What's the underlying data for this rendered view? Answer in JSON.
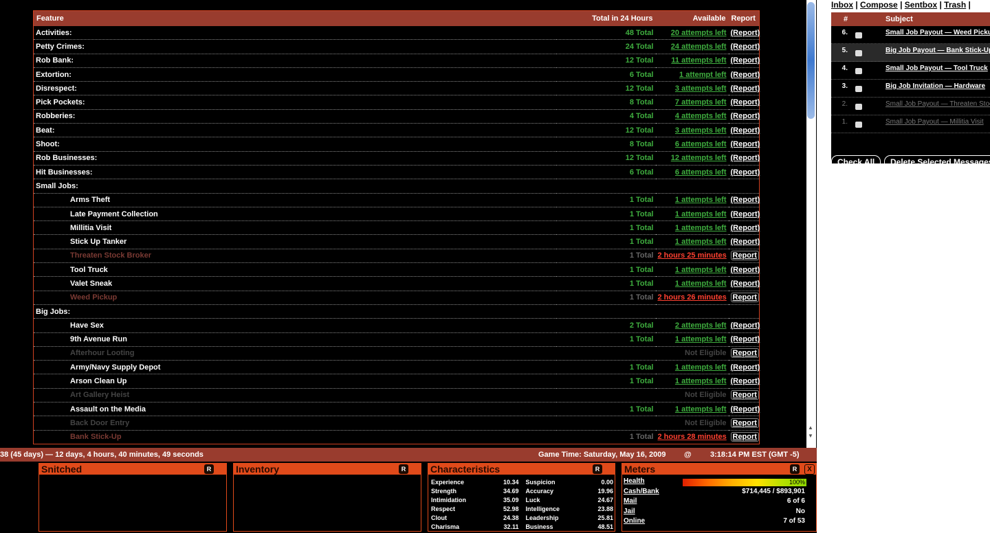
{
  "table": {
    "headers": {
      "feature": "Feature",
      "total": "Total in 24 Hours",
      "available": "Available",
      "report": "Report"
    },
    "rows": [
      {
        "name": "Activities:",
        "total": "48 Total",
        "available": "20 attempts left",
        "report": "(Report)",
        "state": "ok",
        "level": 0
      },
      {
        "name": "Petty Crimes:",
        "total": "24 Total",
        "available": "24 attempts left",
        "report": "(Report)",
        "state": "ok",
        "level": 0
      },
      {
        "name": "Rob Bank:",
        "total": "12 Total",
        "available": "11 attempts left",
        "report": "(Report)",
        "state": "ok",
        "level": 0
      },
      {
        "name": "Extortion:",
        "total": "6 Total",
        "available": "1 attempt left",
        "report": "(Report)",
        "state": "ok",
        "level": 0
      },
      {
        "name": "Disrespect:",
        "total": "12 Total",
        "available": "3 attempts left",
        "report": "(Report)",
        "state": "ok",
        "level": 0
      },
      {
        "name": "Pick Pockets:",
        "total": "8 Total",
        "available": "7 attempts left",
        "report": "(Report)",
        "state": "ok",
        "level": 0
      },
      {
        "name": "Robberies:",
        "total": "4 Total",
        "available": "4 attempts left",
        "report": "(Report)",
        "state": "ok",
        "level": 0
      },
      {
        "name": "Beat:",
        "total": "12 Total",
        "available": "3 attempts left",
        "report": "(Report)",
        "state": "ok",
        "level": 0
      },
      {
        "name": "Shoot:",
        "total": "8 Total",
        "available": "6 attempts left",
        "report": "(Report)",
        "state": "ok",
        "level": 0
      },
      {
        "name": "Rob Businesses:",
        "total": "12 Total",
        "available": "12 attempts left",
        "report": "(Report)",
        "state": "ok",
        "level": 0
      },
      {
        "name": "Hit Businesses:",
        "total": "6 Total",
        "available": "6 attempts left",
        "report": "(Report)",
        "state": "ok",
        "level": 0
      },
      {
        "name": "Small Jobs:",
        "total": "",
        "available": "",
        "report": "",
        "state": "head",
        "level": 0
      },
      {
        "name": "Arms Theft",
        "total": "1 Total",
        "available": "1 attempts left",
        "report": "(Report)",
        "state": "ok",
        "level": 1
      },
      {
        "name": "Late Payment Collection",
        "total": "1 Total",
        "available": "1 attempts left",
        "report": "(Report)",
        "state": "ok",
        "level": 1
      },
      {
        "name": "Millitia Visit",
        "total": "1 Total",
        "available": "1 attempts left",
        "report": "(Report)",
        "state": "ok",
        "level": 1
      },
      {
        "name": "Stick Up Tanker",
        "total": "1 Total",
        "available": "1 attempts left",
        "report": "(Report)",
        "state": "ok",
        "level": 1
      },
      {
        "name": "Threaten Stock Broker",
        "total": "1 Total",
        "available": "2 hours 25 minutes",
        "report": "Report",
        "state": "dim",
        "level": 1
      },
      {
        "name": "Tool Truck",
        "total": "1 Total",
        "available": "1 attempts left",
        "report": "(Report)",
        "state": "ok",
        "level": 1
      },
      {
        "name": "Valet Sneak",
        "total": "1 Total",
        "available": "1 attempts left",
        "report": "(Report)",
        "state": "ok",
        "level": 1
      },
      {
        "name": "Weed Pickup",
        "total": "1 Total",
        "available": "2 hours 26 minutes",
        "report": "Report",
        "state": "dim",
        "level": 1
      },
      {
        "name": "Big Jobs:",
        "total": "",
        "available": "",
        "report": "",
        "state": "head",
        "level": 0
      },
      {
        "name": "Have Sex",
        "total": "2 Total",
        "available": "2 attempts left",
        "report": "(Report)",
        "state": "ok",
        "level": 1
      },
      {
        "name": "9th Avenue Run",
        "total": "1 Total",
        "available": "1 attempts left",
        "report": "(Report)",
        "state": "ok",
        "level": 1
      },
      {
        "name": "Afterhour Looting",
        "total": "",
        "available": "Not Eligible",
        "report": "Report",
        "state": "ne",
        "level": 1
      },
      {
        "name": "Army/Navy Supply Depot",
        "total": "1 Total",
        "available": "1 attempts left",
        "report": "(Report)",
        "state": "ok",
        "level": 1
      },
      {
        "name": "Arson Clean Up",
        "total": "1 Total",
        "available": "1 attempts left",
        "report": "(Report)",
        "state": "ok",
        "level": 1
      },
      {
        "name": "Art Gallery Heist",
        "total": "",
        "available": "Not Eligible",
        "report": "Report",
        "state": "ne",
        "level": 1
      },
      {
        "name": "Assault on the Media",
        "total": "1 Total",
        "available": "1 attempts left",
        "report": "(Report)",
        "state": "ok",
        "level": 1
      },
      {
        "name": "Back Door Entry",
        "total": "",
        "available": "Not Eligible",
        "report": "Report",
        "state": "ne",
        "level": 1
      },
      {
        "name": "Bank Stick-Up",
        "total": "1 Total",
        "available": "2 hours 28 minutes",
        "report": "Report",
        "state": "dim",
        "level": 1
      }
    ]
  },
  "status": {
    "age": "38 (45 days) — 12 days, 4 hours, 40 minutes, 49 seconds",
    "game_time": "Game Time: Saturday, May 16, 2009",
    "at": "@",
    "clock": "3:18:14 PM EST (GMT -5)"
  },
  "panels": {
    "snitched": {
      "title": "Snitched",
      "badge": "R"
    },
    "inventory": {
      "title": "Inventory",
      "badge": "R"
    },
    "characteristics": {
      "title": "Characteristics",
      "badge": "R",
      "left": [
        {
          "label": "Experience",
          "value": "10.34"
        },
        {
          "label": "Strength",
          "value": "34.69"
        },
        {
          "label": "Intimidation",
          "value": "35.09"
        },
        {
          "label": "Respect",
          "value": "52.98"
        },
        {
          "label": "Clout",
          "value": "24.38"
        },
        {
          "label": "Charisma",
          "value": "32.11"
        }
      ],
      "right": [
        {
          "label": "Suspicion",
          "value": "0.00"
        },
        {
          "label": "Accuracy",
          "value": "19.96"
        },
        {
          "label": "Luck",
          "value": "24.67"
        },
        {
          "label": "Intelligence",
          "value": "23.88"
        },
        {
          "label": "Leadership",
          "value": "25.81"
        },
        {
          "label": "Business",
          "value": "48.51"
        }
      ]
    },
    "meters": {
      "title": "Meters",
      "badge": "R",
      "close": "X",
      "health_label": "Health",
      "health_pct": "100%",
      "health_fraction": 1.0,
      "cash_label": "Cash/Bank",
      "cash_value": "$714,445 / $893,901",
      "mail_label": "Mail",
      "mail_value": "6 of 6",
      "jail_label": "Jail",
      "jail_value": "No",
      "online_label": "Online",
      "online_value": "7 of 53"
    }
  },
  "mail": {
    "nav": {
      "inbox": "Inbox",
      "compose": "Compose",
      "sentbox": "Sentbox",
      "trash": "Trash",
      "sep": "|"
    },
    "headers": {
      "num": "#",
      "subject": "Subject"
    },
    "rows": [
      {
        "num": "6.",
        "subject": "Small Job Payout — Weed Pickup",
        "read": false
      },
      {
        "num": "5.",
        "subject": "Big Job Payout — Bank Stick-Up",
        "read": false
      },
      {
        "num": "4.",
        "subject": "Small Job Payout — Tool Truck",
        "read": false
      },
      {
        "num": "3.",
        "subject": "Big Job Invitation — Hardware",
        "read": false
      },
      {
        "num": "2.",
        "subject": "Small Job Payout — Threaten Stock Broker",
        "read": true
      },
      {
        "num": "1.",
        "subject": "Small Job Payout — Millitia Visit",
        "read": true
      }
    ],
    "check_all": "Check All",
    "delete_selected": "Delete Selected Messages"
  }
}
